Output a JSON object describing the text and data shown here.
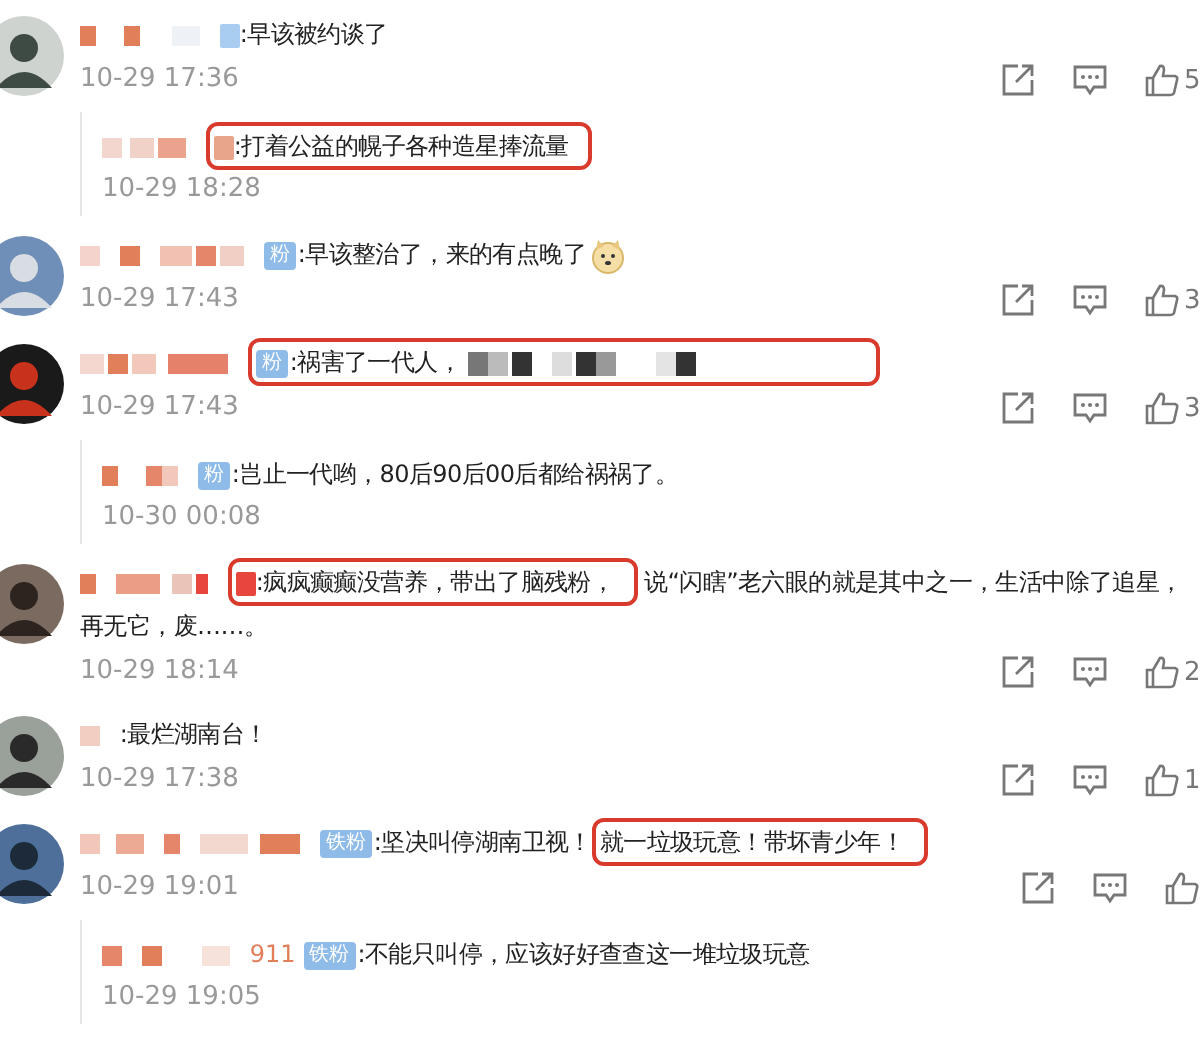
{
  "comments": [
    {
      "text": [
        {
          "kind": "badge-mark",
          "color": "#a9cdf0",
          "highlighted": false
        },
        {
          "kind": "text",
          "value": ":早该被约谈了",
          "highlighted": false
        }
      ],
      "time": "10-29 17:36",
      "likes": "5",
      "replies": [
        {
          "text": [
            {
              "kind": "badge-mark",
              "color": "#e9a58c",
              "highlighted": true
            },
            {
              "kind": "text",
              "value": ":打着公益的幌子各种造星捧流量",
              "highlighted": true
            }
          ],
          "time": "10-29 18:28"
        }
      ]
    },
    {
      "text": [
        {
          "kind": "badge",
          "value": "粉",
          "highlighted": false
        },
        {
          "kind": "text",
          "value": ":早该整治了，来的有点晚了",
          "highlighted": false
        },
        {
          "kind": "emoji",
          "highlighted": false
        }
      ],
      "time": "10-29 17:43",
      "likes": "3"
    },
    {
      "text": [
        {
          "kind": "badge",
          "value": "粉",
          "highlighted": true
        },
        {
          "kind": "text",
          "value": ":祸害了一代人，",
          "highlighted": true
        },
        {
          "kind": "redacted",
          "highlighted": true
        }
      ],
      "time": "10-29 17:43",
      "likes": "3",
      "replies": [
        {
          "text": [
            {
              "kind": "badge",
              "value": "粉",
              "highlighted": false
            },
            {
              "kind": "text",
              "value": ":岂止一代哟，80后90后00后都给祸祸了。",
              "highlighted": false
            }
          ],
          "time": "10-30 00:08"
        }
      ]
    },
    {
      "text": [
        {
          "kind": "badge-mark",
          "color": "#e8453c",
          "highlighted": true
        },
        {
          "kind": "text",
          "value": ":疯疯癫癫没营养，带出了脑残粉，",
          "highlighted": true
        },
        {
          "kind": "text",
          "value": "说“闪瞎”老六眼的就是其中之一，生活中除了追星，",
          "highlighted": false
        },
        {
          "kind": "text-line",
          "value": "再无它，废……。",
          "highlighted": false
        }
      ],
      "time": "10-29 18:14",
      "likes": "2"
    },
    {
      "text": [
        {
          "kind": "text",
          "value": ":最烂湖南台！",
          "highlighted": false
        }
      ],
      "time": "10-29 17:38",
      "likes": "1"
    },
    {
      "text": [
        {
          "kind": "badge",
          "value": "铁粉",
          "highlighted": false
        },
        {
          "kind": "text",
          "value": ":坚决叫停湖南卫视！",
          "highlighted": false
        },
        {
          "kind": "text",
          "value": "就一垃圾玩意！带坏青少年！",
          "highlighted": true
        }
      ],
      "time": "10-29 19:01",
      "replies": [
        {
          "text": [
            {
              "kind": "name",
              "value": "911",
              "highlighted": false
            },
            {
              "kind": "badge",
              "value": "铁粉",
              "highlighted": false
            },
            {
              "kind": "text",
              "value": ":不能只叫停，应该好好查查这一堆垃圾玩意",
              "highlighted": false
            }
          ],
          "time": "10-29 19:05"
        }
      ]
    }
  ]
}
